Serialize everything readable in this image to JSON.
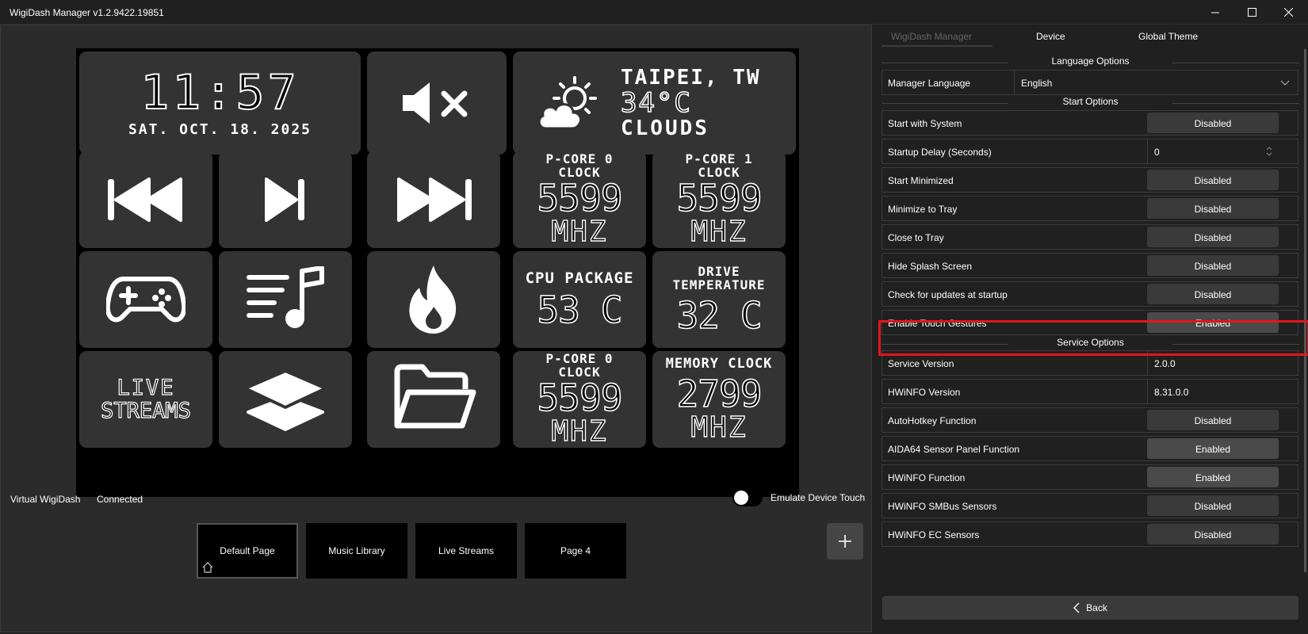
{
  "window": {
    "title": "WigiDash Manager v1.2.9422.19851"
  },
  "tiles": {
    "clock": {
      "time": "11:57",
      "date": "SAT. OCT. 18. 2025"
    },
    "weather": {
      "city": "TAIPEI, TW",
      "temp": "34°C",
      "condition": "CLOUDS"
    },
    "pcore0": {
      "label1": "P-CORE 0",
      "label2": "CLOCK",
      "value": "5599",
      "unit": "MHZ"
    },
    "pcore1": {
      "label1": "P-CORE 1",
      "label2": "CLOCK",
      "value": "5599",
      "unit": "MHZ"
    },
    "cpu_package": {
      "label": "CPU PACKAGE",
      "value": "53 C"
    },
    "drive_temp": {
      "label1": "DRIVE",
      "label2": "TEMPERATURE",
      "value": "32 C"
    },
    "live_streams": {
      "line1": "LIVE",
      "line2": "STREAMS"
    },
    "pcore0b": {
      "label1": "P-CORE 0",
      "label2": "CLOCK",
      "value": "5599",
      "unit": "MHZ"
    },
    "memory": {
      "label": "MEMORY CLOCK",
      "value": "2799",
      "unit": "MHZ"
    }
  },
  "status": {
    "device": "Virtual WigiDash",
    "state": "Connected",
    "emulate_label": "Emulate Device Touch"
  },
  "pages": [
    "Default Page",
    "Music Library",
    "Live Streams",
    "Page 4"
  ],
  "tabs": [
    "WigiDash Manager",
    "Device",
    "Global Theme"
  ],
  "sections": {
    "language": "Language Options",
    "start": "Start Options",
    "service": "Service Options"
  },
  "language": {
    "label": "Manager Language",
    "value": "English"
  },
  "start_options": [
    {
      "label": "Start with System",
      "value": "Disabled"
    },
    {
      "label": "Startup Delay (Seconds)",
      "value": "0"
    },
    {
      "label": "Start Minimized",
      "value": "Disabled"
    },
    {
      "label": "Minimize to Tray",
      "value": "Disabled"
    },
    {
      "label": "Close to Tray",
      "value": "Disabled"
    },
    {
      "label": "Hide Splash Screen",
      "value": "Disabled"
    },
    {
      "label": "Check for updates at startup",
      "value": "Disabled"
    },
    {
      "label": "Enable Touch Gestures",
      "value": "Enabled"
    }
  ],
  "service_options": [
    {
      "label": "Service Version",
      "value": "2.0.0"
    },
    {
      "label": "HWiNFO Version",
      "value": "8.31.0.0"
    },
    {
      "label": "AutoHotkey Function",
      "value": "Disabled"
    },
    {
      "label": "AIDA64 Sensor Panel Function",
      "value": "Enabled"
    },
    {
      "label": "HWiNFO Function",
      "value": "Enabled"
    },
    {
      "label": "HWiNFO SMBus Sensors",
      "value": "Disabled"
    },
    {
      "label": "HWiNFO EC Sensors",
      "value": "Disabled"
    }
  ],
  "back_label": "Back"
}
